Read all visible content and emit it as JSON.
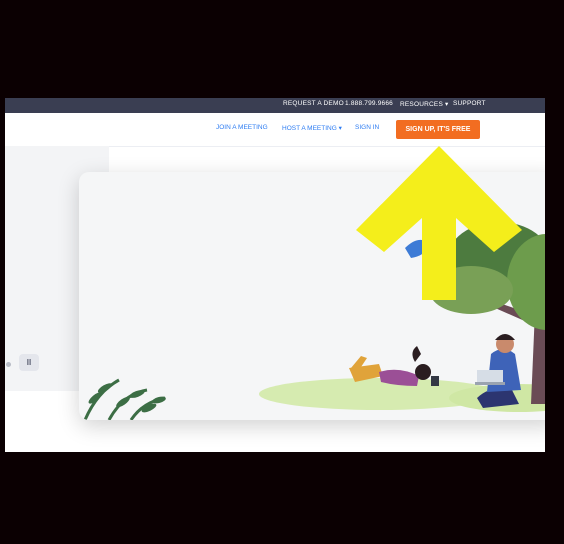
{
  "colors": {
    "frame": "#0b0002",
    "topbar": "#3a3e52",
    "link": "#2d7cf2",
    "signup": "#f26d21",
    "arrow": "#f4ee1b"
  },
  "topbar": {
    "request_demo": "REQUEST A DEMO",
    "phone": "1.888.799.9666",
    "resources": "RESOURCES",
    "support": "SUPPORT"
  },
  "nav": {
    "join": "JOIN A MEETING",
    "host": "HOST A MEETING",
    "signin": "SIGN IN",
    "signup": "SIGN UP, IT'S FREE"
  },
  "controls": {
    "pause_icon": "pause-icon",
    "dot_icon": "carousel-dot-icon"
  },
  "overlay": {
    "arrow_icon": "arrow-up-icon"
  }
}
